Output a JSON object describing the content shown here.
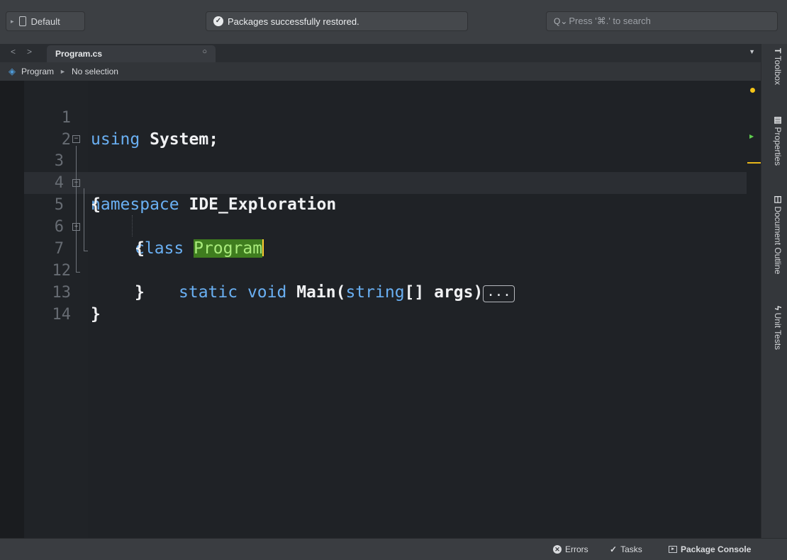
{
  "toolbar": {
    "configuration": "Default",
    "status_text": "Packages successfully restored.",
    "search_placeholder": "Press '⌘.' to search"
  },
  "tab": {
    "file_name": "Program.cs"
  },
  "breadcrumb": {
    "item": "Program",
    "selection": "No selection"
  },
  "editor": {
    "lines": [
      {
        "number": "1",
        "text": "using System;"
      },
      {
        "number": "2",
        "text": ""
      },
      {
        "number": "3",
        "text": "namespace IDE_Exploration"
      },
      {
        "number": "4",
        "text": "{"
      },
      {
        "number": "5",
        "text": "class Program"
      },
      {
        "number": "6",
        "text": "{"
      },
      {
        "number": "7",
        "text": "static void Main(string[] args)"
      },
      {
        "number": "12",
        "text": "}"
      },
      {
        "number": "13",
        "text": "}"
      },
      {
        "number": "14",
        "text": ""
      }
    ],
    "tokens": {
      "using": "using",
      "system": "System;",
      "namespace": "namespace",
      "ns_name": "IDE_Exploration",
      "brace_open": "{",
      "brace_close": "}",
      "class": "class",
      "class_name": "Program",
      "static": "static",
      "void": "void",
      "main": "Main(",
      "string": "string",
      "args": "[] args)",
      "collapsed": "..."
    },
    "current_line": 5
  },
  "side_pads": {
    "toolbox": "Toolbox",
    "properties": "Properties",
    "document_outline": "Document Outline",
    "unit_tests": "Unit Tests"
  },
  "status_bar": {
    "errors": "Errors",
    "tasks": "Tasks",
    "package_console": "Package Console"
  },
  "colors": {
    "keyword": "#6ab0f3",
    "highlight_bg": "#3f7d1f",
    "highlight_fg": "#a9eb7c",
    "cursor": "#ffcc33",
    "marker_warning": "#f5c518",
    "marker_ok": "#5fcf4e"
  }
}
